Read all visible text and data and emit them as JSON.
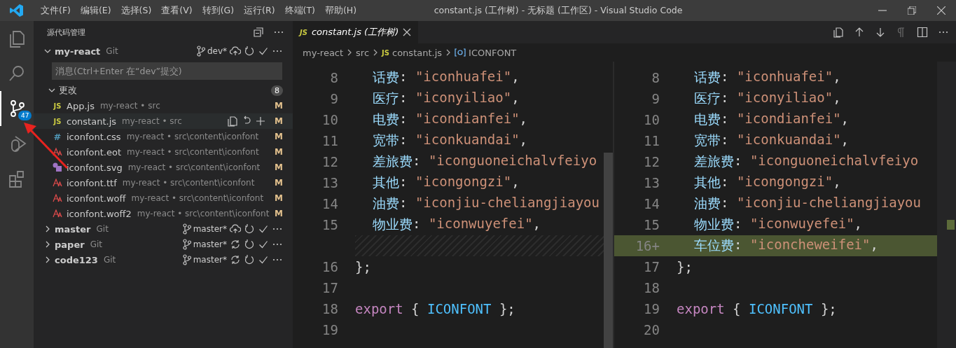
{
  "window": {
    "title": "constant.js (工作树) - 无标题 (工作区) - Visual Studio Code"
  },
  "menu": [
    "文件(F)",
    "编辑(E)",
    "选择(S)",
    "查看(V)",
    "转到(G)",
    "运行(R)",
    "终端(T)",
    "帮助(H)"
  ],
  "activity_bar": [
    {
      "kind": "explorer",
      "selected": false
    },
    {
      "kind": "search",
      "selected": false
    },
    {
      "kind": "scm",
      "selected": true,
      "badge": "47"
    },
    {
      "kind": "debug",
      "selected": false
    },
    {
      "kind": "extensions",
      "selected": false
    }
  ],
  "sidebar": {
    "title": "源代码管理",
    "repositories": [
      {
        "name": "my-react",
        "provider": "Git",
        "branch": "dev*",
        "kind": "publish",
        "expanded": true,
        "message_placeholder": "消息(Ctrl+Enter 在“dev”提交)",
        "changes": {
          "label": "更改",
          "count": "8",
          "expanded": true,
          "files": [
            {
              "kind": "js",
              "icon_text": "JS",
              "name": "App.js",
              "path": "my-react • src",
              "status": "M",
              "selected": false
            },
            {
              "kind": "js",
              "icon_text": "JS",
              "name": "constant.js",
              "path": "my-react • src",
              "status": "M",
              "selected": true
            },
            {
              "kind": "css",
              "icon_text": "#",
              "name": "iconfont.css",
              "path": "my-react • src\\content\\iconfont",
              "status": "M",
              "selected": false
            },
            {
              "kind": "font",
              "name": "iconfont.eot",
              "path": "my-react • src\\content\\iconfont",
              "status": "M",
              "selected": false
            },
            {
              "kind": "svg",
              "name": "iconfont.svg",
              "path": "my-react • src\\content\\iconfont",
              "status": "M",
              "selected": false
            },
            {
              "kind": "font",
              "name": "iconfont.ttf",
              "path": "my-react • src\\content\\iconfont",
              "status": "M",
              "selected": false
            },
            {
              "kind": "font",
              "name": "iconfont.woff",
              "path": "my-react • src\\content\\iconfont",
              "status": "M",
              "selected": false
            },
            {
              "kind": "font",
              "name": "iconfont.woff2",
              "path": "my-react • src\\content\\iconfont",
              "status": "M",
              "selected": false
            }
          ]
        }
      },
      {
        "name": "master",
        "provider": "Git",
        "branch": "master*",
        "kind": "publish",
        "expanded": false
      },
      {
        "name": "paper",
        "provider": "Git",
        "branch": "master*",
        "kind": "sync",
        "expanded": false
      },
      {
        "name": "code123",
        "provider": "Git",
        "branch": "master*",
        "kind": "sync",
        "expanded": false
      }
    ]
  },
  "editor": {
    "tab": {
      "icon_text": "JS",
      "label": "constant.js (工作树)"
    },
    "breadcrumb": [
      {
        "kind": "folder",
        "label": "my-react"
      },
      {
        "kind": "folder",
        "label": "src"
      },
      {
        "kind": "file",
        "icon_text": "JS",
        "label": "constant.js"
      },
      {
        "kind": "symbol",
        "label": "ICONFONT"
      }
    ],
    "panes": [
      {
        "lines": [
          {
            "n": "8",
            "kind": "property",
            "tokens": [
              {
                "t": "话费",
                "kind": "key"
              },
              {
                "t": ": ",
                "kind": "punct"
              },
              {
                "t": "\"iconhuafei\"",
                "kind": "string"
              },
              {
                "t": ",",
                "kind": "punct"
              }
            ]
          },
          {
            "n": "9",
            "kind": "property",
            "tokens": [
              {
                "t": "医疗",
                "kind": "key"
              },
              {
                "t": ": ",
                "kind": "punct"
              },
              {
                "t": "\"iconyiliao\"",
                "kind": "string"
              },
              {
                "t": ",",
                "kind": "punct"
              }
            ]
          },
          {
            "n": "10",
            "kind": "property",
            "tokens": [
              {
                "t": "电费",
                "kind": "key"
              },
              {
                "t": ": ",
                "kind": "punct"
              },
              {
                "t": "\"icondianfei\"",
                "kind": "string"
              },
              {
                "t": ",",
                "kind": "punct"
              }
            ]
          },
          {
            "n": "11",
            "kind": "property",
            "tokens": [
              {
                "t": "宽带",
                "kind": "key"
              },
              {
                "t": ": ",
                "kind": "punct"
              },
              {
                "t": "\"iconkuandai\"",
                "kind": "string"
              },
              {
                "t": ",",
                "kind": "punct"
              }
            ]
          },
          {
            "n": "12",
            "kind": "property",
            "tokens": [
              {
                "t": "差旅费",
                "kind": "key"
              },
              {
                "t": ": ",
                "kind": "punct"
              },
              {
                "t": "\"iconguoneichalvfeiyo",
                "kind": "string"
              }
            ]
          },
          {
            "n": "13",
            "kind": "property",
            "tokens": [
              {
                "t": "其他",
                "kind": "key"
              },
              {
                "t": ": ",
                "kind": "punct"
              },
              {
                "t": "\"icongongzi\"",
                "kind": "string"
              },
              {
                "t": ",",
                "kind": "punct"
              }
            ]
          },
          {
            "n": "14",
            "kind": "property",
            "tokens": [
              {
                "t": "油费",
                "kind": "key"
              },
              {
                "t": ": ",
                "kind": "punct"
              },
              {
                "t": "\"iconjiu-cheliangjiayou",
                "kind": "string"
              }
            ]
          },
          {
            "n": "15",
            "kind": "property",
            "tokens": [
              {
                "t": "物业费",
                "kind": "key"
              },
              {
                "t": ": ",
                "kind": "punct"
              },
              {
                "t": "\"iconwuyefei\"",
                "kind": "string"
              },
              {
                "t": ",",
                "kind": "punct"
              }
            ]
          },
          {
            "kind": "filler"
          },
          {
            "n": "16",
            "kind": "plain",
            "tokens": [
              {
                "t": "};",
                "kind": "punct"
              }
            ]
          },
          {
            "n": "17",
            "kind": "blank"
          },
          {
            "n": "18",
            "kind": "plain",
            "tokens": [
              {
                "t": "export",
                "kind": "keyword"
              },
              {
                "t": " { ",
                "kind": "punct"
              },
              {
                "t": "ICONFONT",
                "kind": "variable"
              },
              {
                "t": " };",
                "kind": "punct"
              }
            ]
          },
          {
            "n": "19",
            "kind": "blank"
          }
        ]
      },
      {
        "lines": [
          {
            "n": "8",
            "kind": "property",
            "tokens": [
              {
                "t": "话费",
                "kind": "key"
              },
              {
                "t": ": ",
                "kind": "punct"
              },
              {
                "t": "\"iconhuafei\"",
                "kind": "string"
              },
              {
                "t": ",",
                "kind": "punct"
              }
            ]
          },
          {
            "n": "9",
            "kind": "property",
            "tokens": [
              {
                "t": "医疗",
                "kind": "key"
              },
              {
                "t": ": ",
                "kind": "punct"
              },
              {
                "t": "\"iconyiliao\"",
                "kind": "string"
              },
              {
                "t": ",",
                "kind": "punct"
              }
            ]
          },
          {
            "n": "10",
            "kind": "property",
            "tokens": [
              {
                "t": "电费",
                "kind": "key"
              },
              {
                "t": ": ",
                "kind": "punct"
              },
              {
                "t": "\"icondianfei\"",
                "kind": "string"
              },
              {
                "t": ",",
                "kind": "punct"
              }
            ]
          },
          {
            "n": "11",
            "kind": "property",
            "tokens": [
              {
                "t": "宽带",
                "kind": "key"
              },
              {
                "t": ": ",
                "kind": "punct"
              },
              {
                "t": "\"iconkuandai\"",
                "kind": "string"
              },
              {
                "t": ",",
                "kind": "punct"
              }
            ]
          },
          {
            "n": "12",
            "kind": "property",
            "tokens": [
              {
                "t": "差旅费",
                "kind": "key"
              },
              {
                "t": ": ",
                "kind": "punct"
              },
              {
                "t": "\"iconguoneichalvfeiyo",
                "kind": "string"
              }
            ]
          },
          {
            "n": "13",
            "kind": "property",
            "tokens": [
              {
                "t": "其他",
                "kind": "key"
              },
              {
                "t": ": ",
                "kind": "punct"
              },
              {
                "t": "\"icongongzi\"",
                "kind": "string"
              },
              {
                "t": ",",
                "kind": "punct"
              }
            ]
          },
          {
            "n": "14",
            "kind": "property",
            "tokens": [
              {
                "t": "油费",
                "kind": "key"
              },
              {
                "t": ": ",
                "kind": "punct"
              },
              {
                "t": "\"iconjiu-cheliangjiayou",
                "kind": "string"
              }
            ]
          },
          {
            "n": "15",
            "kind": "property",
            "tokens": [
              {
                "t": "物业费",
                "kind": "key"
              },
              {
                "t": ": ",
                "kind": "punct"
              },
              {
                "t": "\"iconwuyefei\"",
                "kind": "string"
              },
              {
                "t": ",",
                "kind": "punct"
              }
            ]
          },
          {
            "n": "16+",
            "kind": "added",
            "tokens": [
              {
                "t": "车位费",
                "kind": "key"
              },
              {
                "t": ": ",
                "kind": "punct"
              },
              {
                "t": "\"iconcheweifei\"",
                "kind": "string"
              },
              {
                "t": ",",
                "kind": "punct"
              }
            ]
          },
          {
            "n": "17",
            "kind": "plain",
            "tokens": [
              {
                "t": "};",
                "kind": "punct"
              }
            ]
          },
          {
            "n": "18",
            "kind": "blank"
          },
          {
            "n": "19",
            "kind": "plain",
            "tokens": [
              {
                "t": "export",
                "kind": "keyword"
              },
              {
                "t": " { ",
                "kind": "punct"
              },
              {
                "t": "ICONFONT",
                "kind": "variable"
              },
              {
                "t": " };",
                "kind": "punct"
              }
            ]
          },
          {
            "n": "20",
            "kind": "blank"
          }
        ]
      }
    ]
  }
}
